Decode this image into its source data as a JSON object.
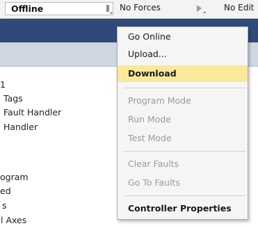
{
  "toolbar": {
    "status": "Offline",
    "forces": "No Forces",
    "edits": "No Edit"
  },
  "tree": {
    "items": [
      "1",
      "Tags",
      "Fault Handler",
      "Handler",
      "ogram",
      "ed",
      "s",
      "l Axes"
    ]
  },
  "menu": {
    "items": [
      {
        "label": "Go Online",
        "state": "enabled"
      },
      {
        "label": "Upload...",
        "state": "enabled"
      },
      {
        "label": "Download",
        "state": "highlighted"
      },
      {
        "label": "Program Mode",
        "state": "disabled"
      },
      {
        "label": "Run Mode",
        "state": "disabled"
      },
      {
        "label": "Test Mode",
        "state": "disabled"
      },
      {
        "label": "Clear Faults",
        "state": "disabled"
      },
      {
        "label": "Go To Faults",
        "state": "disabled"
      },
      {
        "label": "Controller Properties",
        "state": "enabled"
      }
    ]
  },
  "colors": {
    "highlight": "#fbe99a",
    "band": "#2f4a78",
    "disabled_text": "#9a9a9a"
  }
}
